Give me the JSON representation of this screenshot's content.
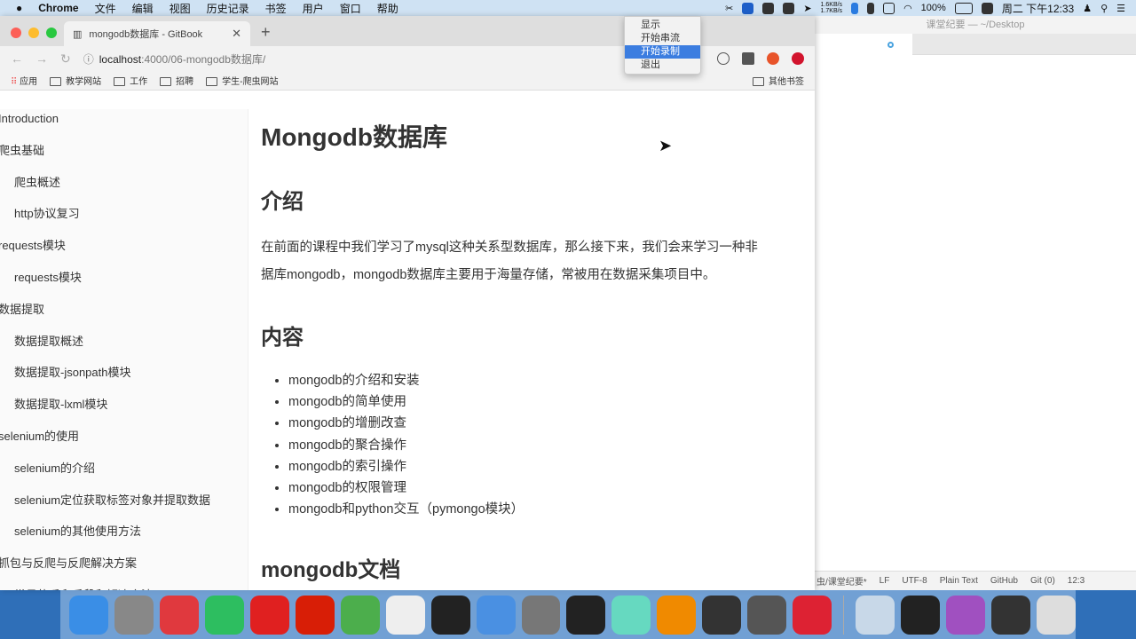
{
  "menubar": {
    "app": "Chrome",
    "items": [
      "文件",
      "编辑",
      "视图",
      "历史记录",
      "书签",
      "用户",
      "窗口",
      "帮助"
    ],
    "net_up": "1.6KB/s",
    "net_down": "1.7KB/s",
    "battery": "100%",
    "clock": "周二 下午12:33"
  },
  "dropdown": {
    "items": [
      "显示",
      "开始串流",
      "开始录制",
      "退出"
    ],
    "selected": 2
  },
  "browser": {
    "tab_title": "mongodb数据库 - GitBook",
    "url_host": "localhost",
    "url_path": ":4000/06-mongodb数据库/",
    "bookmarks": [
      "应用",
      "教学网站",
      "工作",
      "招聘",
      "学生-爬虫网站"
    ],
    "other_bookmarks": "其他书签"
  },
  "sidebar": {
    "items": [
      {
        "label": "Introduction",
        "level": 1
      },
      {
        "label": "爬虫基础",
        "level": 1
      },
      {
        "label": "爬虫概述",
        "level": 2
      },
      {
        "label": "http协议复习",
        "level": 2
      },
      {
        "label": "requests模块",
        "level": 1
      },
      {
        "label": "requests模块",
        "level": 2
      },
      {
        "label": "数据提取",
        "level": 1
      },
      {
        "label": "数据提取概述",
        "level": 2
      },
      {
        "label": "数据提取-jsonpath模块",
        "level": 2
      },
      {
        "label": "数据提取-lxml模块",
        "level": 2
      },
      {
        "label": "selenium的使用",
        "level": 1
      },
      {
        "label": "selenium的介绍",
        "level": 2
      },
      {
        "label": "selenium定位获取标签对象并提取数据",
        "level": 2
      },
      {
        "label": "selenium的其他使用方法",
        "level": 2
      },
      {
        "label": "抓包与反爬与反爬解决方案",
        "level": 1
      },
      {
        "label": "常见的反爬手段和解决方法",
        "level": 2
      }
    ]
  },
  "main": {
    "title": "Mongodb数据库",
    "intro_heading": "介绍",
    "intro_lines": [
      "在前面的课程中我们学习了mysql这种关系型数据库，那么接下来，我们会来学习一种非",
      "据库mongodb，mongodb数据库主要用于海量存储，常被用在数据采集项目中。"
    ],
    "content_heading": "内容",
    "content_items": [
      "mongodb的介绍和安装",
      "mongodb的简单使用",
      "mongodb的增删改查",
      "mongodb的聚合操作",
      "mongodb的索引操作",
      "mongodb的权限管理",
      "mongodb和python交互（pymongo模块）"
    ],
    "doc_heading": "mongodb文档"
  },
  "editor": {
    "title": "课堂纪要 — ~/Desktop",
    "status": [
      "虫/课堂纪要*",
      "LF",
      "UTF-8",
      "Plain Text",
      "GitHub",
      "Git (0)",
      "12:3"
    ]
  }
}
